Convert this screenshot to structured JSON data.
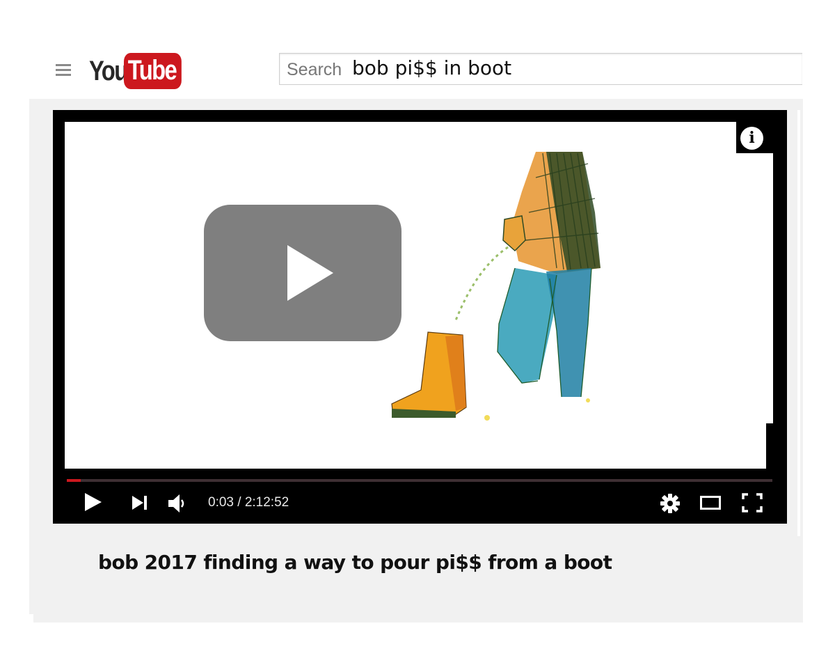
{
  "header": {
    "logo": {
      "you": "You",
      "tube": "Tube"
    },
    "search": {
      "placeholder": "Search",
      "value": "bob pi$$ in boot"
    }
  },
  "player": {
    "time_current": "0:03",
    "time_separator": " / ",
    "time_total": "2:12:52",
    "progress": 0.0004,
    "info_label": "i"
  },
  "video": {
    "title": "bob 2017 finding a way to pour pi$$ from a boot"
  },
  "colors": {
    "brand_red": "#cc181e",
    "player_bg": "#000000",
    "page_gray": "#f1f1f1"
  }
}
